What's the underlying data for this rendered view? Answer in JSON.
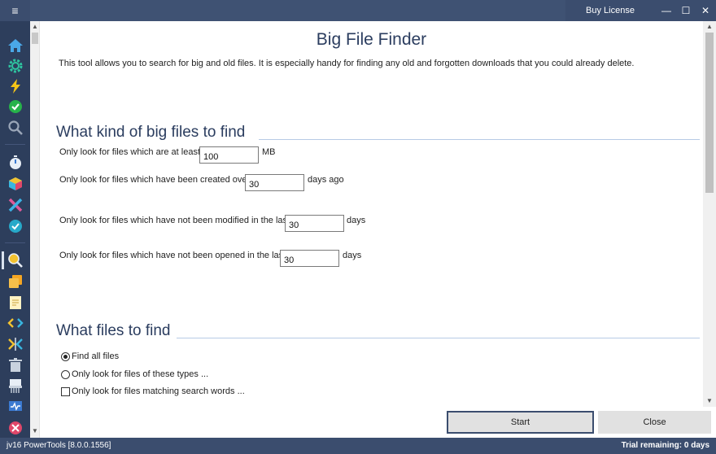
{
  "titlebar": {
    "menu_icon": "hamburger-icon",
    "buy_license": "Buy License",
    "minimize": "—",
    "maximize": "☐",
    "close": "✕"
  },
  "nav_icons": [
    "home-icon",
    "gear-icon",
    "lightning-icon",
    "checkmark-icon",
    "search-icon",
    "stopwatch-icon",
    "cube-icon",
    "x-tools-icon",
    "refresh-check-icon",
    "zoom-file-icon",
    "duplicate-files-icon",
    "notepad-icon",
    "code-icon",
    "split-icon",
    "trash-icon",
    "shredder-icon",
    "monitor-icon",
    "uninstall-icon"
  ],
  "page": {
    "title": "Big File Finder",
    "description": "This tool allows you to search for big and old files. It is especially handy for finding any old and forgotten downloads that you could already delete."
  },
  "section1": {
    "heading": "What kind of big files to find",
    "rows": [
      {
        "label": "Only look for files which are at least:",
        "value": "100",
        "unit": "MB"
      },
      {
        "label": "Only look for files which have been created over",
        "value": "30",
        "unit": "days ago"
      },
      {
        "label": "Only look for files which have not been modified in the last",
        "value": "30",
        "unit": "days"
      },
      {
        "label": "Only look for files which have not been opened in the last",
        "value": "30",
        "unit": "days"
      }
    ]
  },
  "section2": {
    "heading": "What files to find",
    "options": [
      {
        "label": "Find all files",
        "type": "radio",
        "checked": true
      },
      {
        "label": "Only look for files of these types ...",
        "type": "radio",
        "checked": false
      },
      {
        "label": "Only look for files matching search words ...",
        "type": "checkbox",
        "checked": false
      }
    ]
  },
  "buttons": {
    "start": "Start",
    "close": "Close"
  },
  "status": {
    "version": "jv16 PowerTools [8.0.0.1556]",
    "trial": "Trial remaining: 0 days"
  },
  "colors": {
    "titlebar": "#3b4d6e",
    "nav": "#2d3e5c",
    "heading": "#2b3d5f",
    "accent_line": "#b7cbe5"
  }
}
